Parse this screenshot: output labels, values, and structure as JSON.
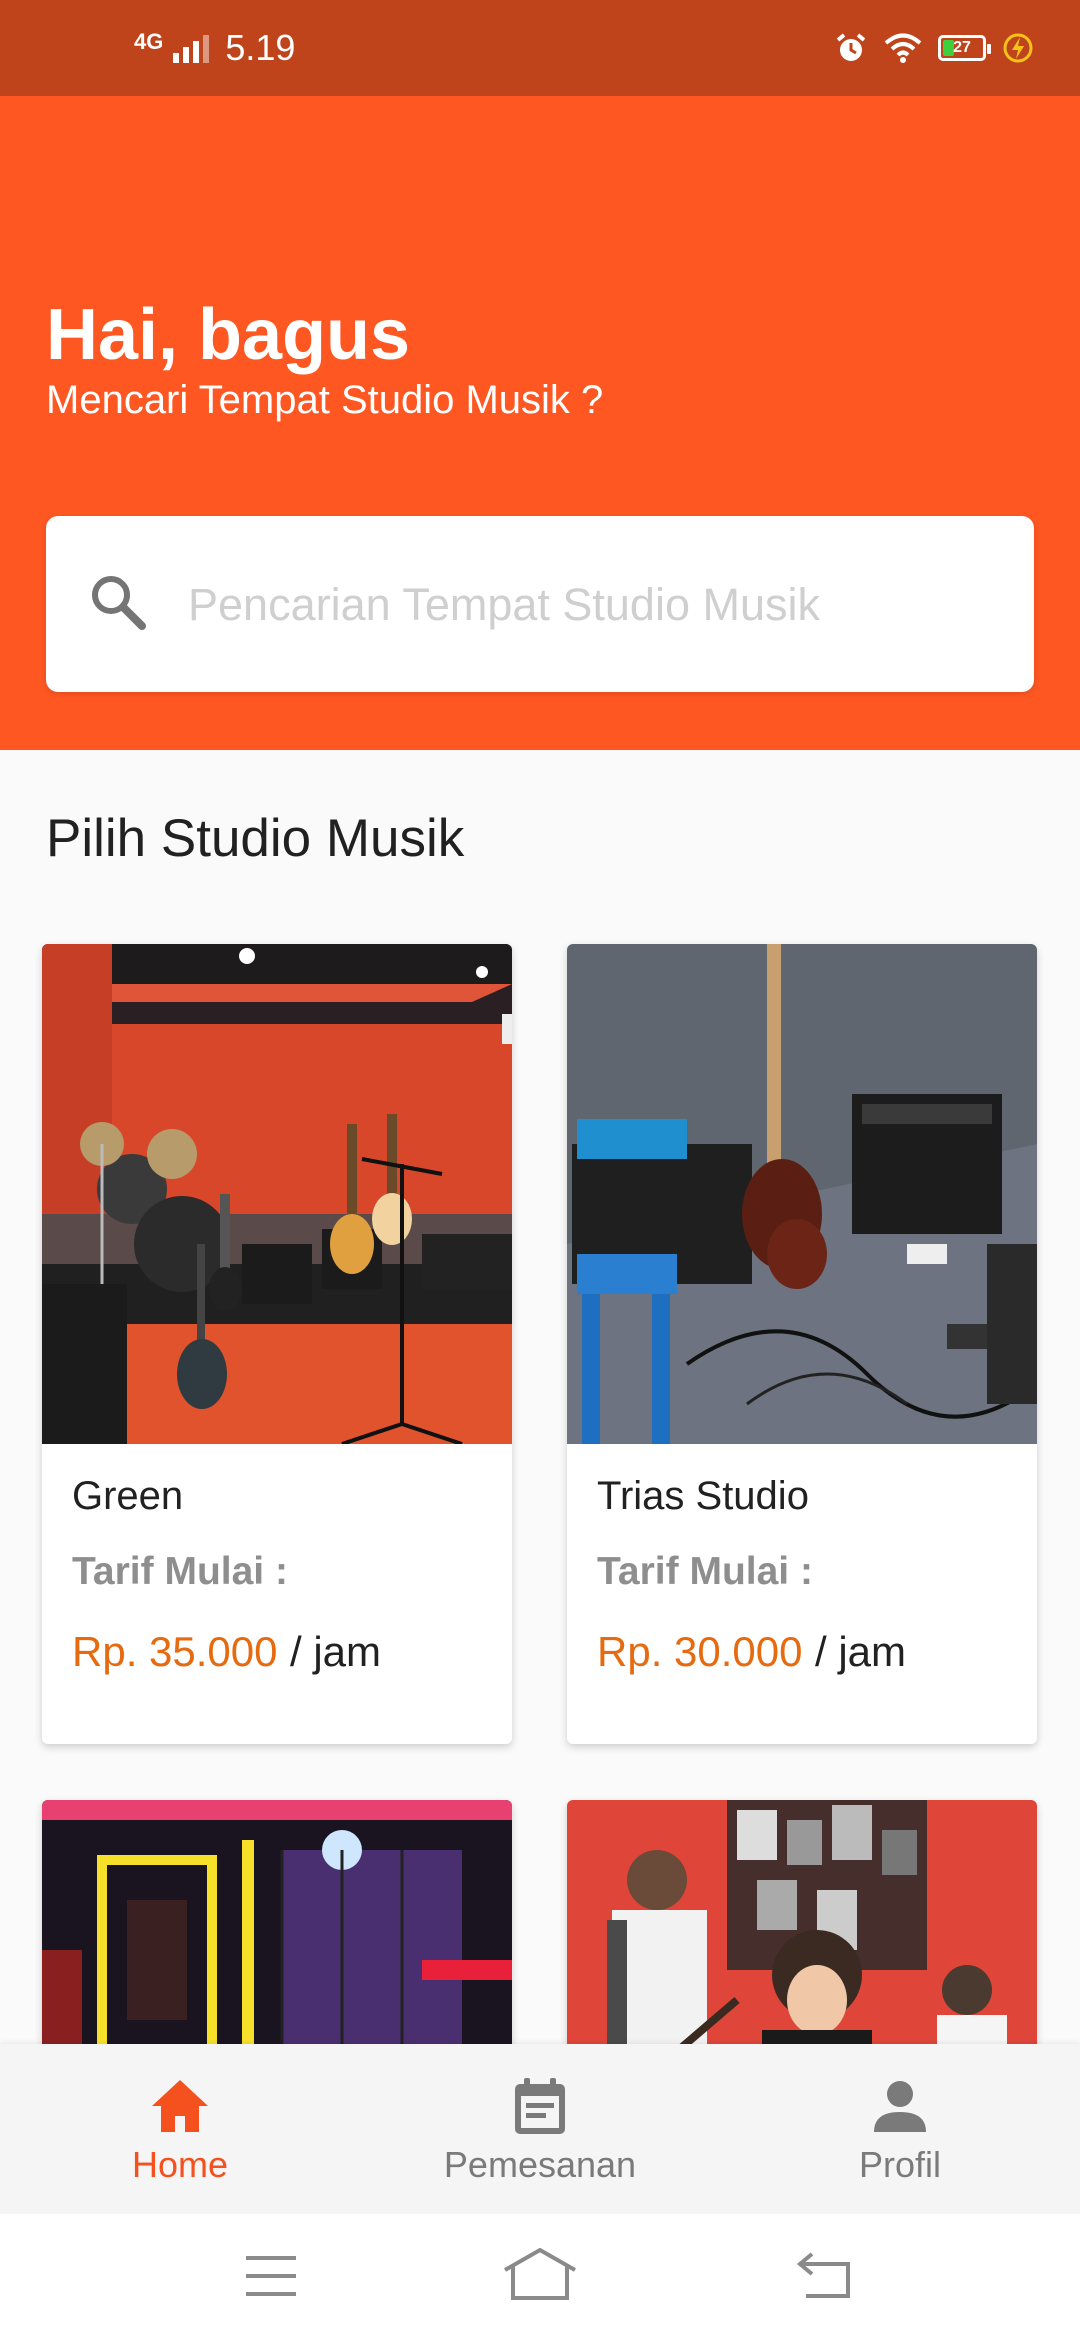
{
  "status_bar": {
    "network": "4G",
    "time": "5.19",
    "battery": "27",
    "battery_level": 0.27,
    "icons": [
      "alarm-icon",
      "wifi-icon",
      "battery-icon",
      "charging-icon"
    ]
  },
  "header": {
    "greeting": "Hai, bagus",
    "subtitle": "Mencari Tempat Studio Musik ?",
    "search_placeholder": "Pencarian Tempat Studio Musik",
    "search_value": ""
  },
  "section_title": "Pilih Studio Musik",
  "studios": [
    {
      "name": "Green",
      "tarif_label": "Tarif Mulai :",
      "price": "Rp. 35.000",
      "unit": "/ jam"
    },
    {
      "name": "Trias Studio",
      "tarif_label": "Tarif Mulai :",
      "price": "Rp. 30.000",
      "unit": "/ jam"
    }
  ],
  "bottom_nav": {
    "items": [
      {
        "label": "Home",
        "icon": "home-icon",
        "active": true
      },
      {
        "label": "Pemesanan",
        "icon": "calendar-icon",
        "active": false
      },
      {
        "label": "Profil",
        "icon": "person-icon",
        "active": false
      }
    ]
  },
  "colors": {
    "status_bar": "#bf441b",
    "header": "#fe5722",
    "price": "#e66a0f",
    "nav_active": "#f4511e",
    "nav_inactive": "#7a7a7a"
  }
}
